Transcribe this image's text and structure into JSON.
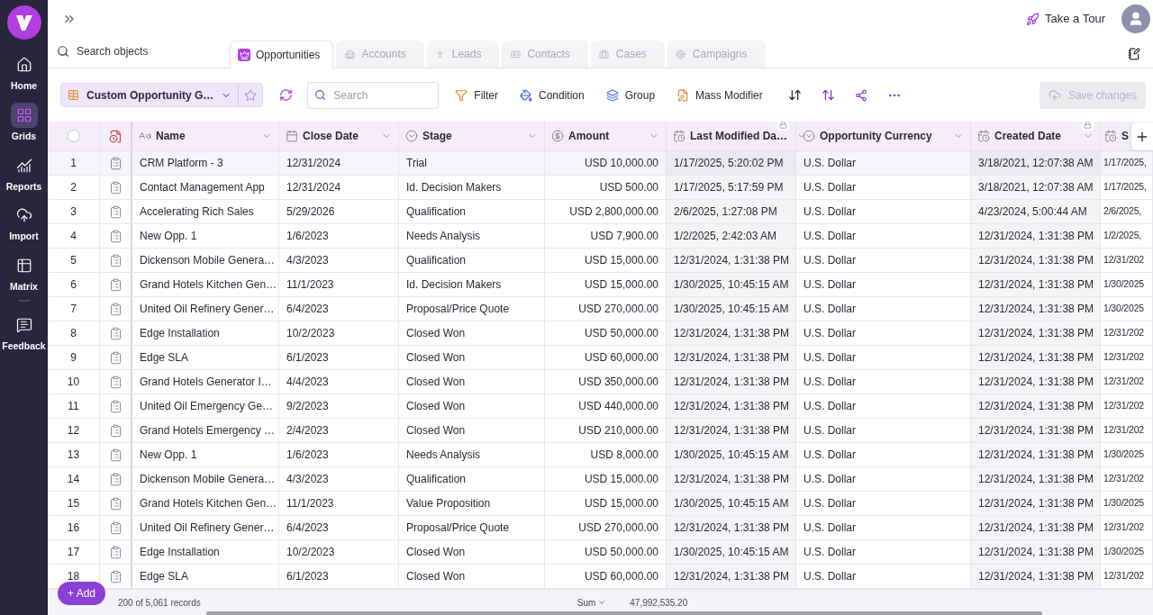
{
  "sidebar": {
    "items": [
      {
        "label": "Home",
        "selected": false
      },
      {
        "label": "Grids",
        "selected": true
      },
      {
        "label": "Reports",
        "selected": false
      },
      {
        "label": "Import",
        "selected": false
      },
      {
        "label": "Matrix",
        "selected": false
      },
      {
        "label": "Feedback",
        "selected": false
      }
    ]
  },
  "header": {
    "tour": "Take a Tour"
  },
  "object_search": {
    "placeholder": "Search objects"
  },
  "tabs": [
    {
      "label": "Opportunities",
      "selected": true
    },
    {
      "label": "Accounts",
      "selected": false
    },
    {
      "label": "Leads",
      "selected": false
    },
    {
      "label": "Contacts",
      "selected": false
    },
    {
      "label": "Cases",
      "selected": false
    },
    {
      "label": "Campaigns",
      "selected": false
    }
  ],
  "toolbar": {
    "view": "Custom Opportunity G…",
    "search_placeholder": "Search",
    "actions": [
      "Filter",
      "Condition",
      "Group",
      "Mass Modifier"
    ],
    "save": {
      "label": "Save changes",
      "disabled": true
    }
  },
  "table": {
    "select_all": {
      "checked": false
    },
    "columns": [
      {
        "label": "Name",
        "kind": "text",
        "locked": false
      },
      {
        "label": "Close Date",
        "kind": "date",
        "locked": false
      },
      {
        "label": "Stage",
        "kind": "picklist",
        "locked": false
      },
      {
        "label": "Amount",
        "kind": "currency",
        "locked": false
      },
      {
        "label": "Last Modified Da…",
        "kind": "datetime",
        "locked": true
      },
      {
        "label": "Opportunity Currency",
        "kind": "picklist",
        "locked": false
      },
      {
        "label": "Created Date",
        "kind": "datetime",
        "locked": true
      },
      {
        "label": "S",
        "kind": "datetime",
        "locked": false
      }
    ],
    "rows": [
      {
        "number": "1",
        "selected": true,
        "cells": [
          "CRM Platform - 3",
          "12/31/2024",
          "Trial",
          "USD 10,000.00",
          "1/17/2025, 5:20:02 PM",
          "U.S. Dollar",
          "3/18/2021, 12:07:38 AM",
          "1/17/2025,"
        ]
      },
      {
        "number": "2",
        "selected": false,
        "cells": [
          "Contact Management App",
          "12/31/2024",
          "Id. Decision Makers",
          "USD 500.00",
          "1/17/2025, 5:17:59 PM",
          "U.S. Dollar",
          "3/18/2021, 12:07:38 AM",
          "1/17/2025,"
        ]
      },
      {
        "number": "3",
        "selected": false,
        "cells": [
          "Accelerating Rich Sales",
          "5/29/2026",
          "Qualification",
          "USD 2,800,000.00",
          "2/6/2025, 1:27:08 PM",
          "U.S. Dollar",
          "4/23/2024, 5:00:44 AM",
          "2/6/2025,"
        ]
      },
      {
        "number": "4",
        "selected": false,
        "cells": [
          "New Opp. 1",
          "1/6/2023",
          "Needs Analysis",
          "USD 7,900.00",
          "1/2/2025, 2:42:03 AM",
          "U.S. Dollar",
          "12/31/2024, 1:31:38 PM",
          "1/2/2025,"
        ]
      },
      {
        "number": "5",
        "selected": false,
        "cells": [
          "Dickenson Mobile Genera…",
          "4/3/2023",
          "Qualification",
          "USD 15,000.00",
          "12/31/2024, 1:31:38 PM",
          "U.S. Dollar",
          "12/31/2024, 1:31:38 PM",
          "12/31/202"
        ]
      },
      {
        "number": "6",
        "selected": false,
        "cells": [
          "Grand Hotels Kitchen Gen…",
          "11/1/2023",
          "Id. Decision Makers",
          "USD 15,000.00",
          "1/30/2025, 10:45:15 AM",
          "U.S. Dollar",
          "12/31/2024, 1:31:38 PM",
          "1/30/2025"
        ]
      },
      {
        "number": "7",
        "selected": false,
        "cells": [
          "United Oil Refinery Gener…",
          "6/4/2023",
          "Proposal/Price Quote",
          "USD 270,000.00",
          "1/30/2025, 10:45:15 AM",
          "U.S. Dollar",
          "12/31/2024, 1:31:38 PM",
          "1/30/2025"
        ]
      },
      {
        "number": "8",
        "selected": false,
        "cells": [
          "Edge Installation",
          "10/2/2023",
          "Closed Won",
          "USD 50,000.00",
          "12/31/2024, 1:31:38 PM",
          "U.S. Dollar",
          "12/31/2024, 1:31:38 PM",
          "12/31/202"
        ]
      },
      {
        "number": "9",
        "selected": false,
        "cells": [
          "Edge SLA",
          "6/1/2023",
          "Closed Won",
          "USD 60,000.00",
          "12/31/2024, 1:31:38 PM",
          "U.S. Dollar",
          "12/31/2024, 1:31:38 PM",
          "12/31/202"
        ]
      },
      {
        "number": "10",
        "selected": false,
        "cells": [
          "Grand Hotels Generator I…",
          "4/4/2023",
          "Closed Won",
          "USD 350,000.00",
          "12/31/2024, 1:31:38 PM",
          "U.S. Dollar",
          "12/31/2024, 1:31:38 PM",
          "12/31/202"
        ]
      },
      {
        "number": "11",
        "selected": false,
        "cells": [
          "United Oil Emergency Ge…",
          "9/2/2023",
          "Closed Won",
          "USD 440,000.00",
          "12/31/2024, 1:31:38 PM",
          "U.S. Dollar",
          "12/31/2024, 1:31:38 PM",
          "12/31/202"
        ]
      },
      {
        "number": "12",
        "selected": false,
        "cells": [
          "Grand Hotels Emergency …",
          "2/4/2023",
          "Closed Won",
          "USD 210,000.00",
          "12/31/2024, 1:31:38 PM",
          "U.S. Dollar",
          "12/31/2024, 1:31:38 PM",
          "12/31/202"
        ]
      },
      {
        "number": "13",
        "selected": false,
        "cells": [
          "New Opp. 1",
          "1/6/2023",
          "Needs Analysis",
          "USD 8,000.00",
          "1/30/2025, 10:45:15 AM",
          "U.S. Dollar",
          "12/31/2024, 1:31:38 PM",
          "1/30/2025"
        ]
      },
      {
        "number": "14",
        "selected": false,
        "cells": [
          "Dickenson Mobile Genera…",
          "4/3/2023",
          "Qualification",
          "USD 15,000.00",
          "12/31/2024, 1:31:38 PM",
          "U.S. Dollar",
          "12/31/2024, 1:31:38 PM",
          "12/31/202"
        ]
      },
      {
        "number": "15",
        "selected": false,
        "cells": [
          "Grand Hotels Kitchen Gen…",
          "11/1/2023",
          "Value Proposition",
          "USD 15,000.00",
          "1/30/2025, 10:45:15 AM",
          "U.S. Dollar",
          "12/31/2024, 1:31:38 PM",
          "1/30/2025"
        ]
      },
      {
        "number": "16",
        "selected": false,
        "cells": [
          "United Oil Refinery Gener…",
          "6/4/2023",
          "Proposal/Price Quote",
          "USD 270,000.00",
          "12/31/2024, 1:31:38 PM",
          "U.S. Dollar",
          "12/31/2024, 1:31:38 PM",
          "12/31/202"
        ]
      },
      {
        "number": "17",
        "selected": false,
        "cells": [
          "Edge Installation",
          "10/2/2023",
          "Closed Won",
          "USD 50,000.00",
          "1/30/2025, 10:45:15 AM",
          "U.S. Dollar",
          "12/31/2024, 1:31:38 PM",
          "1/30/2025"
        ]
      },
      {
        "number": "18",
        "selected": false,
        "cells": [
          "Edge SLA",
          "6/1/2023",
          "Closed Won",
          "USD 60,000.00",
          "12/31/2024, 1:31:38 PM",
          "U.S. Dollar",
          "12/31/2024, 1:31:38 PM",
          "12/31/202"
        ]
      }
    ]
  },
  "footer": {
    "add": "+ Add",
    "records": "200 of 5,061 records",
    "aggregate": "Sum",
    "total": "47,992,535.20"
  }
}
